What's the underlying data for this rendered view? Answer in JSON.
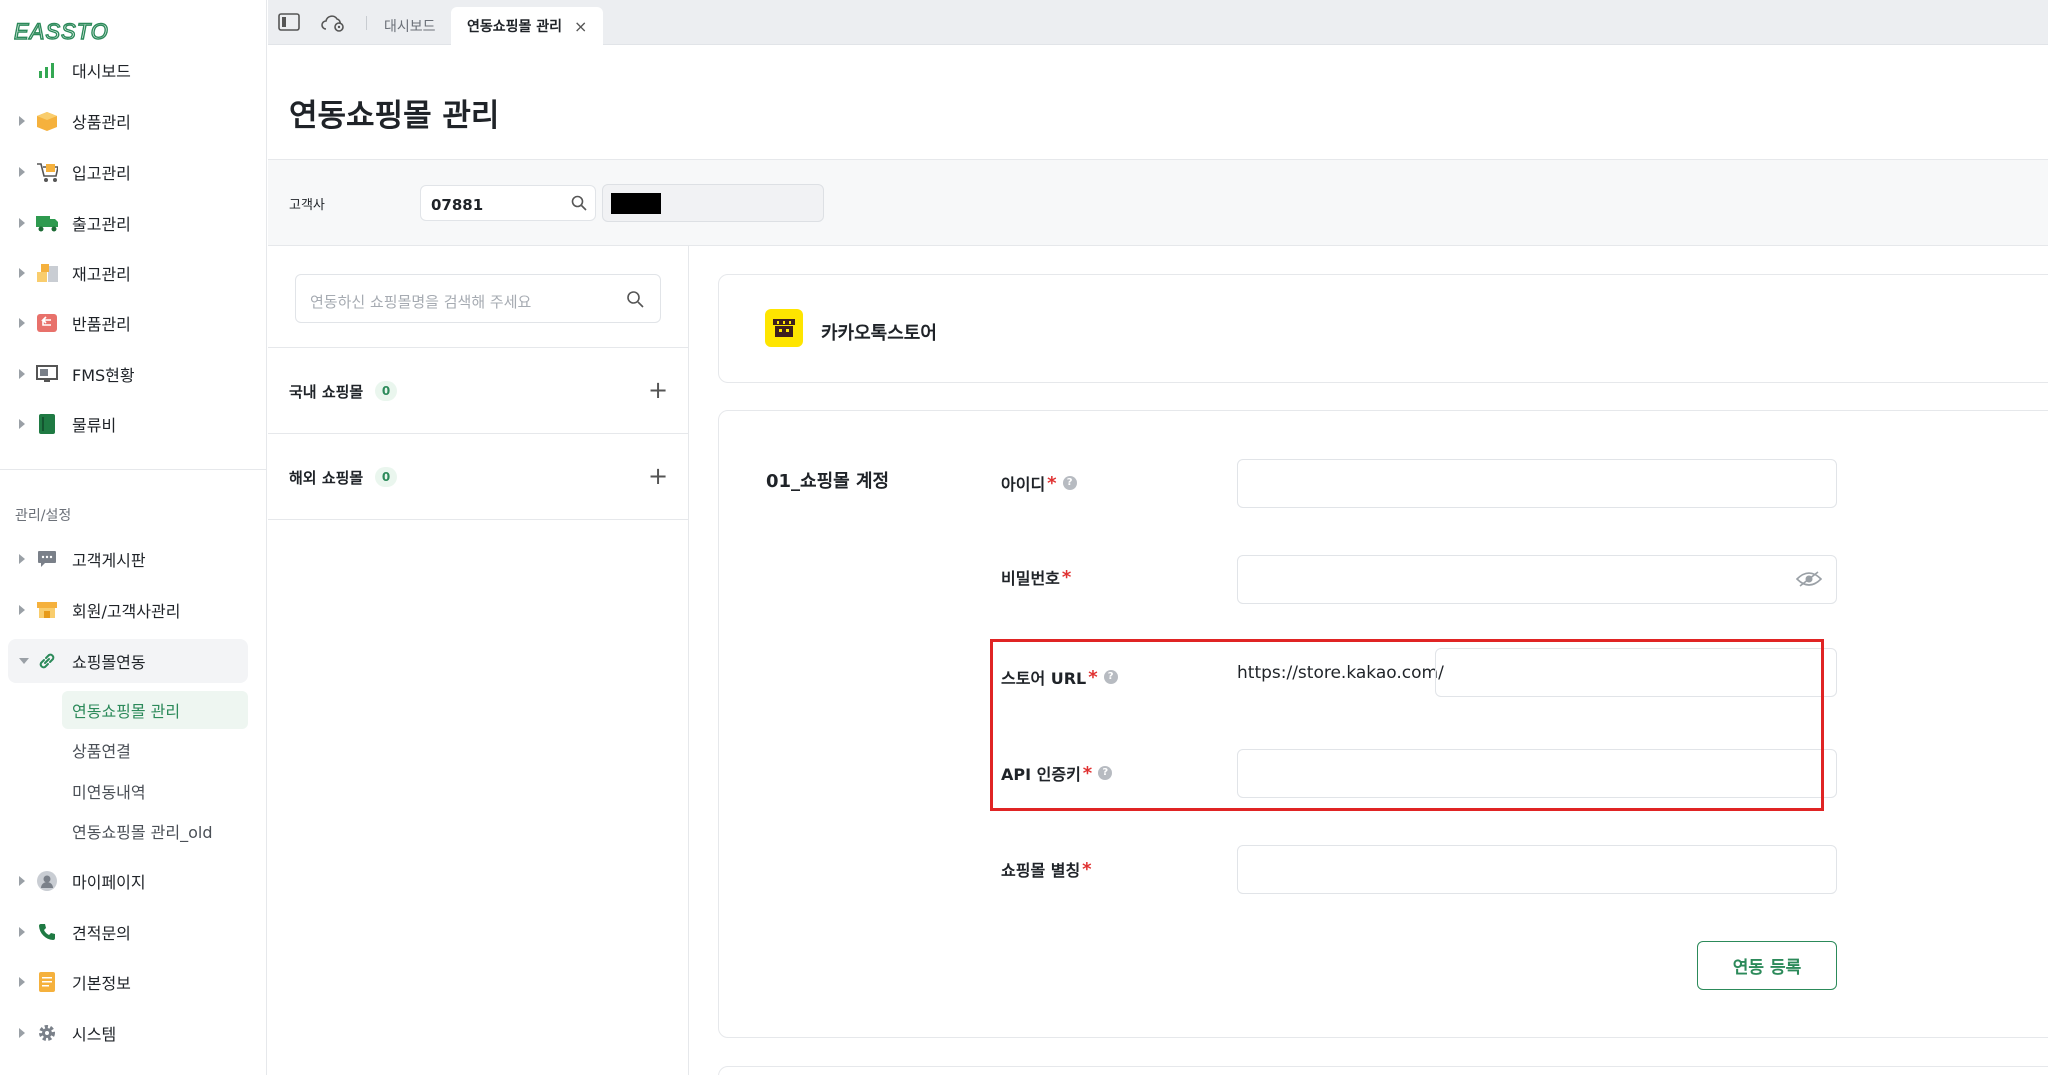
{
  "app": {
    "logo_text": "EASSTO",
    "brand_color": "#2c8a5a"
  },
  "sidebar": {
    "items": [
      {
        "label": "대시보드",
        "icon": "bar-chart-icon"
      },
      {
        "label": "상품관리",
        "icon": "box-icon"
      },
      {
        "label": "입고관리",
        "icon": "cart-icon"
      },
      {
        "label": "출고관리",
        "icon": "truck-icon"
      },
      {
        "label": "재고관리",
        "icon": "boxes-icon"
      },
      {
        "label": "반품관리",
        "icon": "return-icon"
      },
      {
        "label": "FMS현황",
        "icon": "monitor-icon"
      },
      {
        "label": "물류비",
        "icon": "book-icon"
      }
    ],
    "section_title": "관리/설정",
    "settings_items": [
      {
        "label": "고객게시판",
        "icon": "chat-icon"
      },
      {
        "label": "회원/고객사관리",
        "icon": "store-icon"
      },
      {
        "label": "쇼핑몰연동",
        "icon": "link-icon"
      }
    ],
    "sub_items": [
      "연동쇼핑몰 관리",
      "상품연결",
      "미연동내역",
      "연동쇼핑몰 관리_old"
    ],
    "bottom_items": [
      {
        "label": "마이페이지",
        "icon": "user-icon"
      },
      {
        "label": "견적문의",
        "icon": "phone-icon"
      },
      {
        "label": "기본정보",
        "icon": "note-icon"
      },
      {
        "label": "시스템",
        "icon": "gear-icon"
      }
    ]
  },
  "tabs": {
    "items": [
      {
        "label": "대시보드"
      },
      {
        "label": "연동쇼핑몰 관리",
        "close": "×"
      }
    ]
  },
  "page": {
    "title": "연동쇼핑몰 관리"
  },
  "filter": {
    "customer_label": "고객사",
    "customer_code": "07881"
  },
  "mall_list": {
    "search_placeholder": "연동하신 쇼핑몰명을 검색해 주세요",
    "categories": [
      {
        "label": "국내 쇼핑몰",
        "count": "0",
        "add": "+"
      },
      {
        "label": "해외 쇼핑몰",
        "count": "0",
        "add": "+"
      }
    ]
  },
  "store": {
    "name": "카카오톡스토어"
  },
  "form": {
    "section_title": "01_쇼핑몰 계정",
    "fields": [
      {
        "label": "아이디",
        "required": "*",
        "help": "?"
      },
      {
        "label": "비밀번호",
        "required": "*"
      },
      {
        "label": "스토어 URL",
        "required": "*",
        "help": "?",
        "prefix": "https://store.kakao.com/"
      },
      {
        "label": "API 인증키",
        "required": "*",
        "help": "?"
      },
      {
        "label": "쇼핑몰 별칭",
        "required": "*"
      }
    ],
    "submit_label": "연동 등록"
  }
}
